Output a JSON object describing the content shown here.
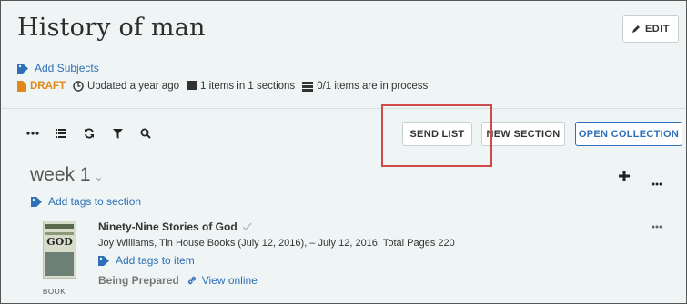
{
  "header": {
    "title": "History of man",
    "edit_label": "EDIT",
    "add_subjects": "Add Subjects",
    "draft": "DRAFT",
    "updated": "Updated a year ago",
    "items_count": "1 items in 1 sections",
    "in_process": "0/1 items are in process"
  },
  "toolbar": {
    "icons": [
      "more-icon",
      "list-icon",
      "refresh-icon",
      "filter-icon",
      "search-icon"
    ],
    "send_list": "SEND LIST",
    "new_section": "NEW SECTION",
    "open_collection": "OPEN COLLECTION"
  },
  "section": {
    "name": "week 1",
    "add_tags": "Add tags to section"
  },
  "item": {
    "title": "Ninety-Nine Stories of God",
    "description": "Joy Williams, Tin House Books (July 12, 2016), – July 12, 2016, Total Pages 220",
    "add_tags": "Add tags to item",
    "status": "Being Prepared",
    "view_online": "View online",
    "type": "BOOK",
    "cover_text": "GOD"
  },
  "colors": {
    "link": "#2e6fb7",
    "draft": "#e0891a",
    "highlight": "#d0494b",
    "background": "#eff5f5"
  }
}
